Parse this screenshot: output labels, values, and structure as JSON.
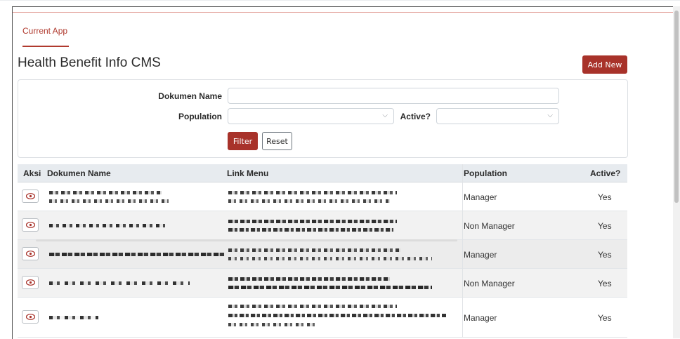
{
  "app_tab": {
    "label": "Current App"
  },
  "page": {
    "title": "Health Benefit Info CMS",
    "add_new_label": "Add New"
  },
  "filters": {
    "dokumen_name_label": "Dokumen Name",
    "dokumen_name_value": "",
    "population_label": "Population",
    "population_value": "",
    "active_label": "Active?",
    "active_value": "",
    "filter_label": "Filter",
    "reset_label": "Reset"
  },
  "table": {
    "columns": [
      "Aksi",
      "Dokumen Name",
      "Link Menu",
      "Population",
      "Active?"
    ],
    "rows": [
      {
        "population": "Manager",
        "active": "Yes"
      },
      {
        "population": "Non Manager",
        "active": "Yes"
      },
      {
        "population": "Manager",
        "active": "Yes"
      },
      {
        "population": "Non Manager",
        "active": "Yes"
      },
      {
        "population": "Manager",
        "active": "Yes"
      }
    ]
  },
  "colors": {
    "accent": "#a8322a",
    "header_bg": "#e7ebef",
    "row_alt": "#f2f2f2"
  },
  "icons": {
    "view": "eye-icon",
    "dropdown": "chevron-down-icon"
  }
}
